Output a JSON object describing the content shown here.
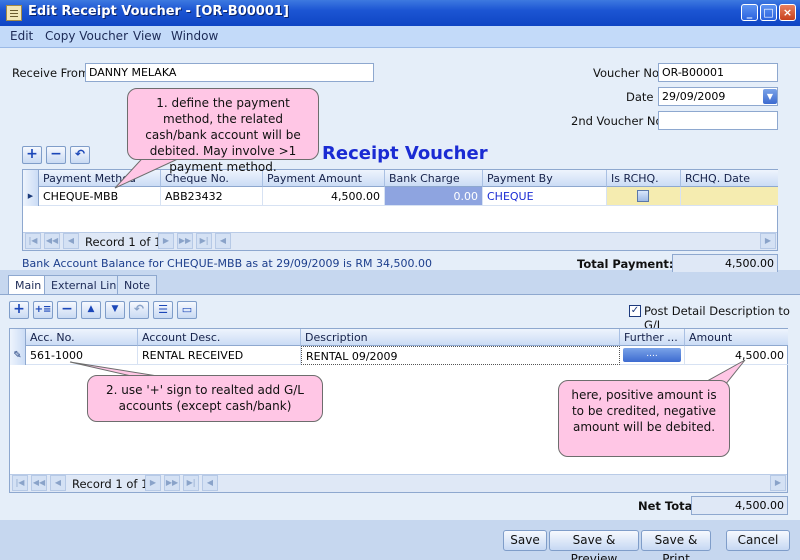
{
  "window": {
    "title": "Edit Receipt Voucher - [OR-B00001]"
  },
  "menu": [
    "Edit",
    "Copy Voucher",
    "View",
    "Window"
  ],
  "header": {
    "receive_from_label": "Receive From",
    "receive_from_value": "DANNY MELAKA",
    "voucher_no_label": "Voucher No",
    "voucher_no_value": "OR-B00001",
    "date_label": "Date",
    "date_value": "29/09/2009",
    "second_voucher_label": "2nd Voucher No",
    "second_voucher_value": ""
  },
  "form_title": "Receipt Voucher",
  "payment_grid": {
    "columns": [
      "Payment Method",
      "Cheque No.",
      "Payment Amount",
      "Bank Charge",
      "Payment By",
      "Is RCHQ.",
      "RCHQ. Date"
    ],
    "rows": [
      {
        "method": "CHEQUE-MBB",
        "cheque_no": "ABB23432",
        "amount": "4,500.00",
        "bank_charge": "0.00",
        "payment_by": "CHEQUE",
        "is_rchq": false,
        "rchq_date": ""
      }
    ],
    "record_text": "Record 1 of 1"
  },
  "bank_balance_text": "Bank Account Balance for CHEQUE-MBB as at 29/09/2009 is RM 34,500.00",
  "total_payment_label": "Total Payment:",
  "total_payment_value": "4,500.00",
  "tabs": [
    "Main",
    "External Link",
    "Note"
  ],
  "post_detail": {
    "label": "Post Detail Description to G/L",
    "checked": true,
    "mark": "✓"
  },
  "detail_grid": {
    "columns": [
      "Acc. No.",
      "Account Desc.",
      "Description",
      "Further ...",
      "Amount"
    ],
    "rows": [
      {
        "acc_no": "561-1000",
        "acc_desc": "RENTAL RECEIVED",
        "description": "RENTAL 09/2009",
        "further": "....",
        "amount": "4,500.00"
      }
    ],
    "record_text": "Record 1 of 1"
  },
  "net_total_label": "Net Total",
  "net_total_value": "4,500.00",
  "callouts": {
    "payment": "1. define the payment method, the related cash/bank account will be debited. May involve >1 payment method.",
    "gl": "2. use '+' sign to realted add G/L accounts (except cash/bank)",
    "amount": "here, positive amount is to be credited, negative amount will be debited."
  },
  "buttons": {
    "save": "Save",
    "save_preview": "Save & Preview",
    "save_print": "Save & Print",
    "cancel": "Cancel"
  },
  "icons": {
    "add": "+",
    "remove": "−",
    "undo": "↶",
    "min": "_",
    "max": "□",
    "close": "×"
  }
}
